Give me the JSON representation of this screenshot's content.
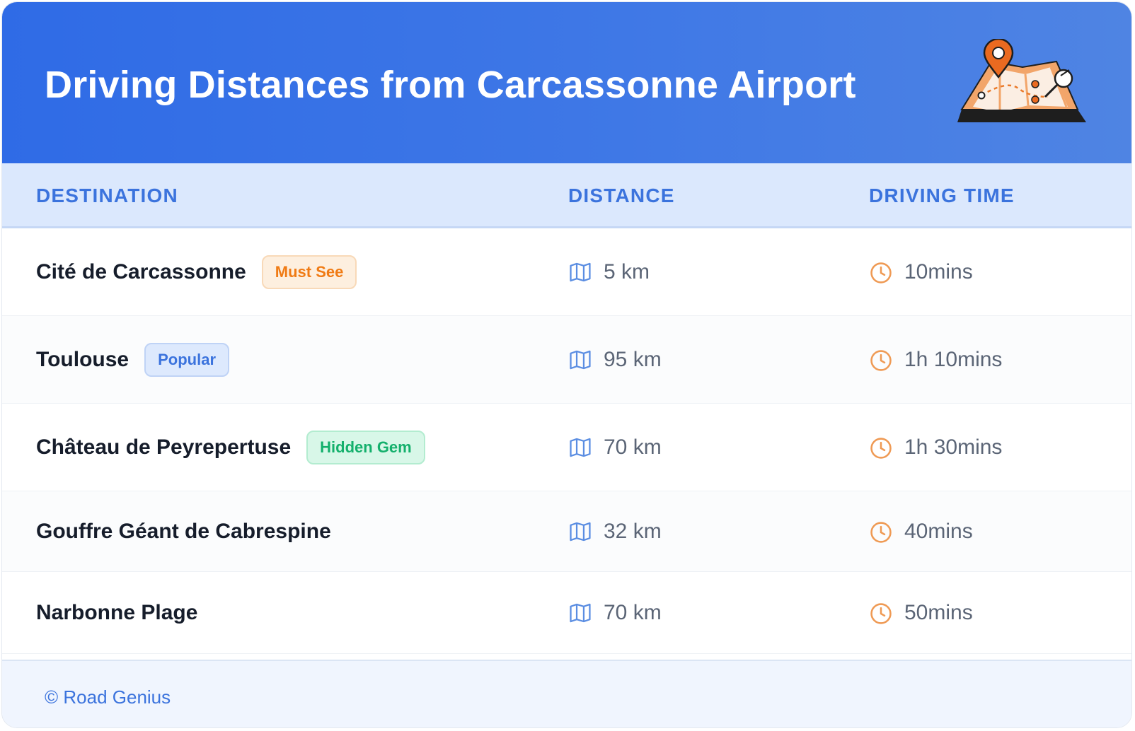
{
  "header": {
    "title": "Driving Distances from Carcassonne Airport",
    "illustration_icon": "map-with-pin-icon"
  },
  "table": {
    "columns": [
      "DESTINATION",
      "DISTANCE",
      "DRIVING TIME"
    ],
    "rows": [
      {
        "destination": "Cité de Carcassonne",
        "badge": "Must See",
        "badge_style": "orange",
        "distance": "5 km",
        "time": "10mins"
      },
      {
        "destination": "Toulouse",
        "badge": "Popular",
        "badge_style": "blue",
        "distance": "95 km",
        "time": "1h 10mins"
      },
      {
        "destination": "Château de Peyrepertuse",
        "badge": "Hidden Gem",
        "badge_style": "green",
        "distance": "70 km",
        "time": "1h 30mins"
      },
      {
        "destination": "Gouffre Géant de Cabrespine",
        "badge": "",
        "badge_style": "",
        "distance": "32 km",
        "time": "40mins"
      },
      {
        "destination": "Narbonne Plage",
        "badge": "",
        "badge_style": "",
        "distance": "70 km",
        "time": "50mins"
      }
    ]
  },
  "footer": {
    "copyright": "© Road Genius"
  },
  "colors": {
    "header_bg": "#2f6be6",
    "accent_blue": "#3b73dd",
    "badge_orange": {
      "bg": "#fdefdf",
      "border": "#f8d9b8",
      "text": "#f07b14"
    },
    "badge_blue": {
      "bg": "#dde9fd",
      "border": "#bfd3f6",
      "text": "#3b73dd"
    },
    "badge_green": {
      "bg": "#d8f7e8",
      "border": "#b3ecd0",
      "text": "#14b06c"
    },
    "distance_icon": "#5a8de2",
    "time_icon": "#ef9a54"
  },
  "icons": {
    "distance": "folded-map-icon",
    "time": "clock-icon"
  }
}
